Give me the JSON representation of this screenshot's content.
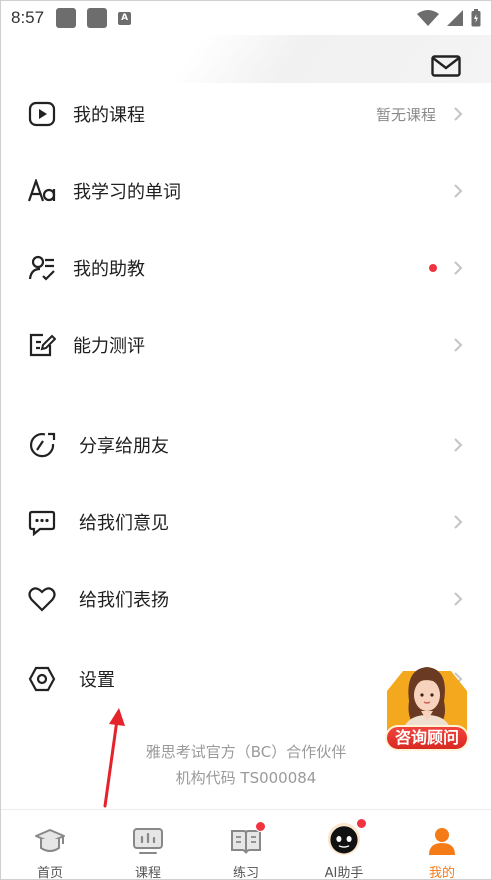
{
  "status_bar": {
    "time": "8:57",
    "a_icon_text": "A"
  },
  "menu": {
    "items": [
      {
        "label": "我的课程",
        "value": "暂无课程"
      },
      {
        "label": "我学习的单词",
        "value": ""
      },
      {
        "label": "我的助教",
        "value": ""
      },
      {
        "label": "能力测评",
        "value": ""
      },
      {
        "label": "分享给朋友",
        "value": ""
      },
      {
        "label": "给我们意见",
        "value": ""
      },
      {
        "label": "给我们表扬",
        "value": ""
      },
      {
        "label": "设置",
        "value": ""
      }
    ]
  },
  "footer": {
    "partner": "雅思考试官方（BC）合作伙伴",
    "code": "机构代码 TS000084"
  },
  "consult": {
    "label": "咨询顾问"
  },
  "bottom_nav": {
    "items": [
      {
        "label": "首页"
      },
      {
        "label": "课程"
      },
      {
        "label": "练习"
      },
      {
        "label": "AI助手"
      },
      {
        "label": "我的"
      }
    ]
  },
  "colors": {
    "accent": "#f57b17",
    "badge": "#f1333f",
    "arrow": "#e4232b"
  }
}
